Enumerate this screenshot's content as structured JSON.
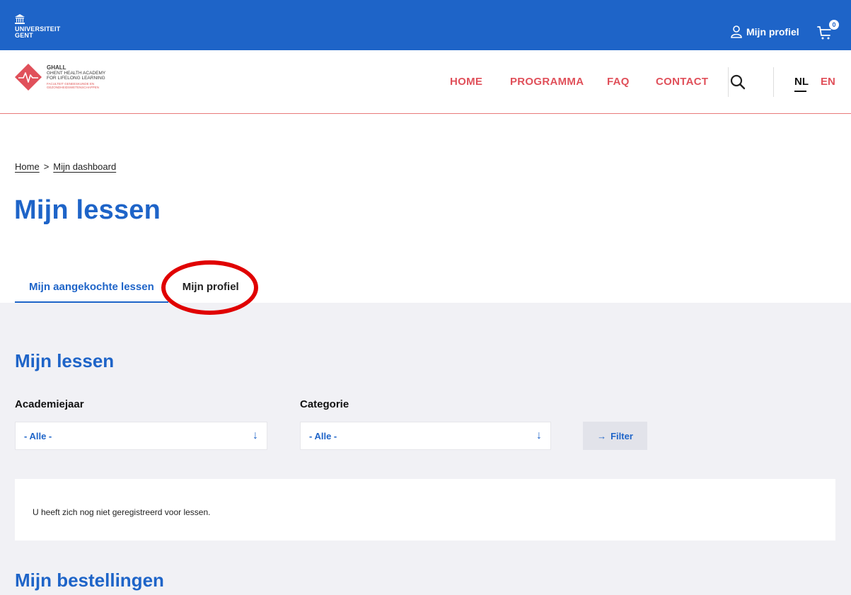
{
  "topbar": {
    "logo_line1": "UNIVERSITEIT",
    "logo_line2": "GENT",
    "profile_label": "Mijn profiel",
    "cart_count": "0"
  },
  "brand": {
    "name": "GHALL",
    "sub1": "GHENT HEALTH ACADEMY",
    "sub2": "FOR LIFELONG LEARNING",
    "faculty1": "FACULTEIT GENEESKUNDE EN",
    "faculty2": "GEZONDHEIDSWETENSCHAPPEN",
    "accent": "#e0505a"
  },
  "nav": {
    "items": [
      "HOME",
      "PROGRAMMA",
      "FAQ",
      "CONTACT"
    ],
    "lang_nl": "NL",
    "lang_en": "EN"
  },
  "breadcrumb": {
    "home": "Home",
    "separator": ">",
    "current": "Mijn dashboard"
  },
  "page_title": "Mijn lessen",
  "tabs": [
    {
      "label": "Mijn aangekochte lessen",
      "active": true
    },
    {
      "label": "Mijn profiel",
      "active": false
    }
  ],
  "lessons": {
    "title": "Mijn lessen",
    "year_label": "Academiejaar",
    "year_value": "- Alle -",
    "category_label": "Categorie",
    "category_value": "- Alle -",
    "filter_label": "Filter",
    "empty_message": "U heeft zich nog niet geregistreerd voor lessen."
  },
  "orders": {
    "title": "Mijn bestellingen"
  },
  "colors": {
    "primary": "#1e64c8",
    "panel_bg": "#f1f1f5",
    "annotation": "#e00000"
  }
}
